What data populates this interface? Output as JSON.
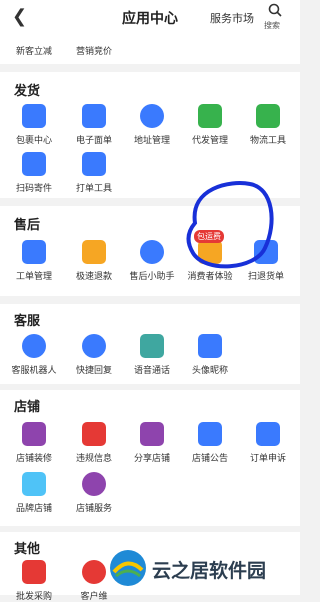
{
  "header": {
    "title": "应用中心",
    "market": "服务市场",
    "search_label": "搜索"
  },
  "top_partial": {
    "items": [
      {
        "label": "新客立减"
      },
      {
        "label": "营销竞价"
      }
    ]
  },
  "sections": {
    "ship": {
      "title": "发货",
      "items": [
        {
          "label": "包裹中心"
        },
        {
          "label": "电子面单"
        },
        {
          "label": "地址管理"
        },
        {
          "label": "代发管理"
        },
        {
          "label": "物流工具"
        },
        {
          "label": "扫码寄件"
        },
        {
          "label": "打单工具"
        }
      ]
    },
    "after": {
      "title": "售后",
      "items": [
        {
          "label": "工单管理"
        },
        {
          "label": "极速退款"
        },
        {
          "label": "售后小助手"
        },
        {
          "label": "消费者体验",
          "badge": "包运费"
        },
        {
          "label": "扫退货单"
        }
      ]
    },
    "service": {
      "title": "客服",
      "items": [
        {
          "label": "客服机器人"
        },
        {
          "label": "快捷回复"
        },
        {
          "label": "语音通话"
        },
        {
          "label": "头像昵称"
        }
      ]
    },
    "shop": {
      "title": "店铺",
      "items": [
        {
          "label": "店铺装修"
        },
        {
          "label": "违规信息"
        },
        {
          "label": "分享店铺"
        },
        {
          "label": "店铺公告"
        },
        {
          "label": "订单申诉"
        },
        {
          "label": "品牌店铺"
        },
        {
          "label": "店铺服务"
        }
      ]
    },
    "other": {
      "title": "其他",
      "items": [
        {
          "label": "批发采购"
        },
        {
          "label": "客户维"
        }
      ]
    }
  },
  "watermark": {
    "text": "云之居软件园"
  },
  "colors": {
    "blue": "#3a7afe",
    "teal": "#3fa7a0",
    "orange": "#f6a623",
    "green": "#37b24d",
    "purple": "#8e44ad",
    "red": "#e53935"
  }
}
